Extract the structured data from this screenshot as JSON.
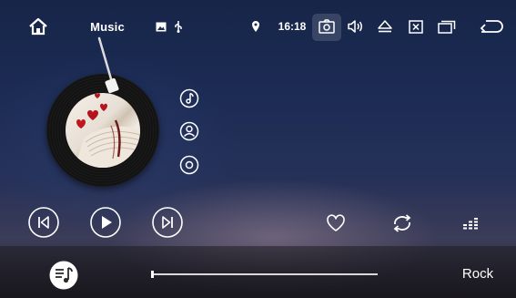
{
  "status_bar": {
    "title": "Music",
    "time": "16:18",
    "icons": [
      "home-icon",
      "image-icon",
      "usb-icon",
      "location-icon",
      "camera-icon",
      "volume-icon",
      "eject-icon",
      "close-box-icon",
      "recent-apps-icon",
      "back-icon"
    ]
  },
  "side_buttons": [
    "music-note-icon",
    "artist-icon",
    "album-icon"
  ],
  "controls": [
    "previous-icon",
    "play-icon",
    "next-icon",
    "favorite-icon",
    "repeat-icon",
    "equalizer-icon"
  ],
  "bottom_bar": {
    "genre": "Rock",
    "progress": 0.0
  }
}
